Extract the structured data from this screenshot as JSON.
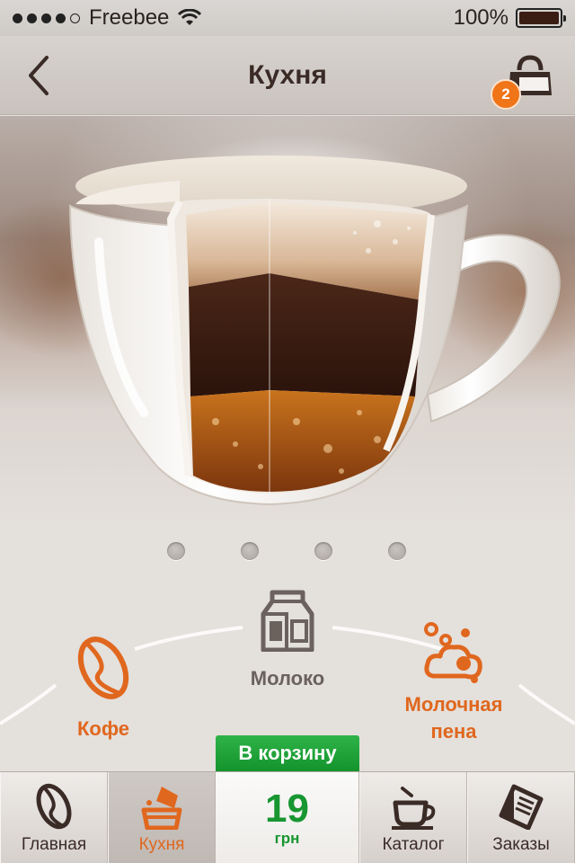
{
  "status_bar": {
    "carrier": "Freebee",
    "battery": "100%",
    "battery_level": 1.0,
    "signal_bars": 4,
    "signal_total": 5
  },
  "nav": {
    "title": "Кухня",
    "cart_count": "2"
  },
  "carousel": {
    "pages": 4
  },
  "ingredients": {
    "milk": "Молоко",
    "coffee": "Кофе",
    "foam_line1": "Молочная",
    "foam_line2": "пена"
  },
  "add_to_cart": "В корзину",
  "price": {
    "value": "19",
    "currency": "грн"
  },
  "tabs": [
    {
      "label": "Главная",
      "icon": "coffee-bean-icon"
    },
    {
      "label": "Кухня",
      "icon": "kitchen-pour-icon"
    },
    {
      "label": "Каталог",
      "icon": "coffee-cup-icon"
    },
    {
      "label": "Заказы",
      "icon": "order-list-icon"
    }
  ],
  "colors": {
    "accent_orange": "#e0671e",
    "price_green": "#179631",
    "cart_green": "#14932c",
    "badge_orange": "#f07418",
    "text_dark": "#3a2b26"
  }
}
